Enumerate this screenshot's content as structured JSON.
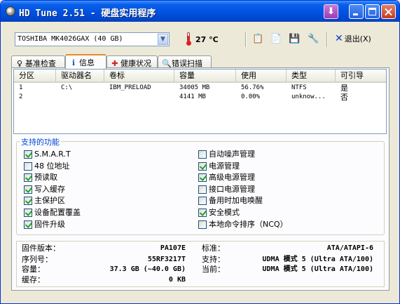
{
  "window": {
    "title": "HD Tune 2.51 - 硬盘实用程序"
  },
  "toolbar": {
    "drive_select": "TOSHIBA MK4026GAX (40 GB)",
    "temperature": "27 °C",
    "exit_label": "退出(X)",
    "icons": [
      "copy-text-icon",
      "copy-screenshot-icon",
      "save-icon",
      "options-icon"
    ]
  },
  "tabs": [
    {
      "label": "基准检查",
      "icon": "benchmark-icon"
    },
    {
      "label": "信息",
      "icon": "info-icon",
      "active": true
    },
    {
      "label": "健康状况",
      "icon": "health-icon"
    },
    {
      "label": "错误扫描",
      "icon": "error-scan-icon"
    }
  ],
  "partitions": {
    "columns": [
      "分区",
      "驱动器名",
      "卷标",
      "容量",
      "使用",
      "类型",
      "可引导"
    ],
    "rows": [
      [
        "1",
        "C:\\",
        "IBM_PRELOAD",
        "34005 MB",
        "56.76%",
        "NTFS",
        "是"
      ],
      [
        "2",
        "",
        "",
        "4141 MB",
        "0.00%",
        "unknow...",
        "否"
      ]
    ]
  },
  "features": {
    "title": "支持的功能",
    "left": [
      {
        "label": "S.M.A.R.T",
        "checked": true
      },
      {
        "label": "48 位地址",
        "checked": false
      },
      {
        "label": "预读取",
        "checked": true
      },
      {
        "label": "写入缓存",
        "checked": true
      },
      {
        "label": "主保护区",
        "checked": true
      },
      {
        "label": "设备配置覆盖",
        "checked": true
      },
      {
        "label": "固件升级",
        "checked": true
      }
    ],
    "right": [
      {
        "label": "自动噪声管理",
        "checked": false
      },
      {
        "label": "电源管理",
        "checked": true
      },
      {
        "label": "高级电源管理",
        "checked": true
      },
      {
        "label": "接口电源管理",
        "checked": false
      },
      {
        "label": "备用时加电唤醒",
        "checked": false
      },
      {
        "label": "安全模式",
        "checked": true
      },
      {
        "label": "本地命令排序（NCQ）",
        "checked": false
      }
    ]
  },
  "info": {
    "firmware_label": "固件版本：",
    "firmware": "PA107E",
    "serial_label": "序列号：",
    "serial": "55RF3217T",
    "capacity_label": "容量：",
    "capacity": "37.3 GB (~40.0 GB)",
    "buffer_label": "缓存：",
    "buffer": "0 KB",
    "standard_label": "标准：",
    "standard": "ATA/ATAPI-6",
    "supported_label": "支持：",
    "supported": "UDMA 模式 5 (Ultra ATA/100)",
    "current_label": "当前：",
    "current": "UDMA 模式 5 (Ultra ATA/100)"
  }
}
